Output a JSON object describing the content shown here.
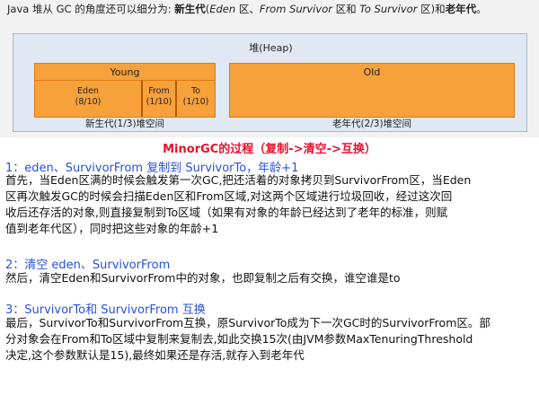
{
  "top_snippet": {
    "intro_part1": "Java 堆从 GC 的角度还可以细分为: ",
    "intro_new_gen": "新生代",
    "intro_part2": "(",
    "intro_eden": "Eden",
    "intro_part3": " 区、",
    "intro_from": "From Survivor",
    "intro_part4": " 区和 ",
    "intro_to": "To Survivor",
    "intro_part5": " 区)和",
    "intro_old_gen": "老年代",
    "intro_part6": "。",
    "heap_label": "堆(Heap)",
    "young_label": "Young",
    "eden_name": "Eden",
    "eden_ratio": "(8/10)",
    "from_name": "From",
    "from_ratio": "(1/10)",
    "to_name": "To",
    "to_ratio": "(1/10)",
    "old_label": "Old",
    "young_caption": "新生代(1/3)堆空间",
    "old_caption": "老年代(2/3)堆空间"
  },
  "minor_gc_title": "MinorGC的过程（复制->清空->互换）",
  "steps": [
    {
      "heading": "1：eden、SurvivorFrom 复制到 SurvivorTo，年龄+1",
      "lines": [
        "首先，当Eden区满的时候会触发第一次GC,把还活着的对象拷贝到SurvivorFrom区，当Eden",
        "区再次触发GC的时候会扫描Eden区和From区域,对这两个区域进行垃圾回收，经过这次回",
        "收后还存活的对象,则直接复制到To区域（如果有对象的年龄已经达到了老年的标准，则赋",
        "值到老年代区），同时把这些对象的年龄+1"
      ]
    },
    {
      "heading": "2：清空 eden、SurvivorFrom",
      "lines": [
        "然后，清空Eden和SurvivorFrom中的对象，也即复制之后有交换，谁空谁是to"
      ]
    },
    {
      "heading": "3：SurvivorTo和 SurvivorFrom 互换",
      "lines": [
        "最后，SurvivorTo和SurvivorFrom互换，原SurvivorTo成为下一次GC时的SurvivorFrom区。部",
        "分对象会在From和To区域中复制来复制去,如此交换15次(由JVM参数MaxTenuringThreshold",
        "决定,这个参数默认是15),最终如果还是存活,就存入到老年代"
      ]
    }
  ],
  "colors": {
    "title_red": "#e8122a",
    "heading_blue": "#2750e6",
    "block_orange": "#f7a13a",
    "heap_bg": "#dfe8f3"
  }
}
